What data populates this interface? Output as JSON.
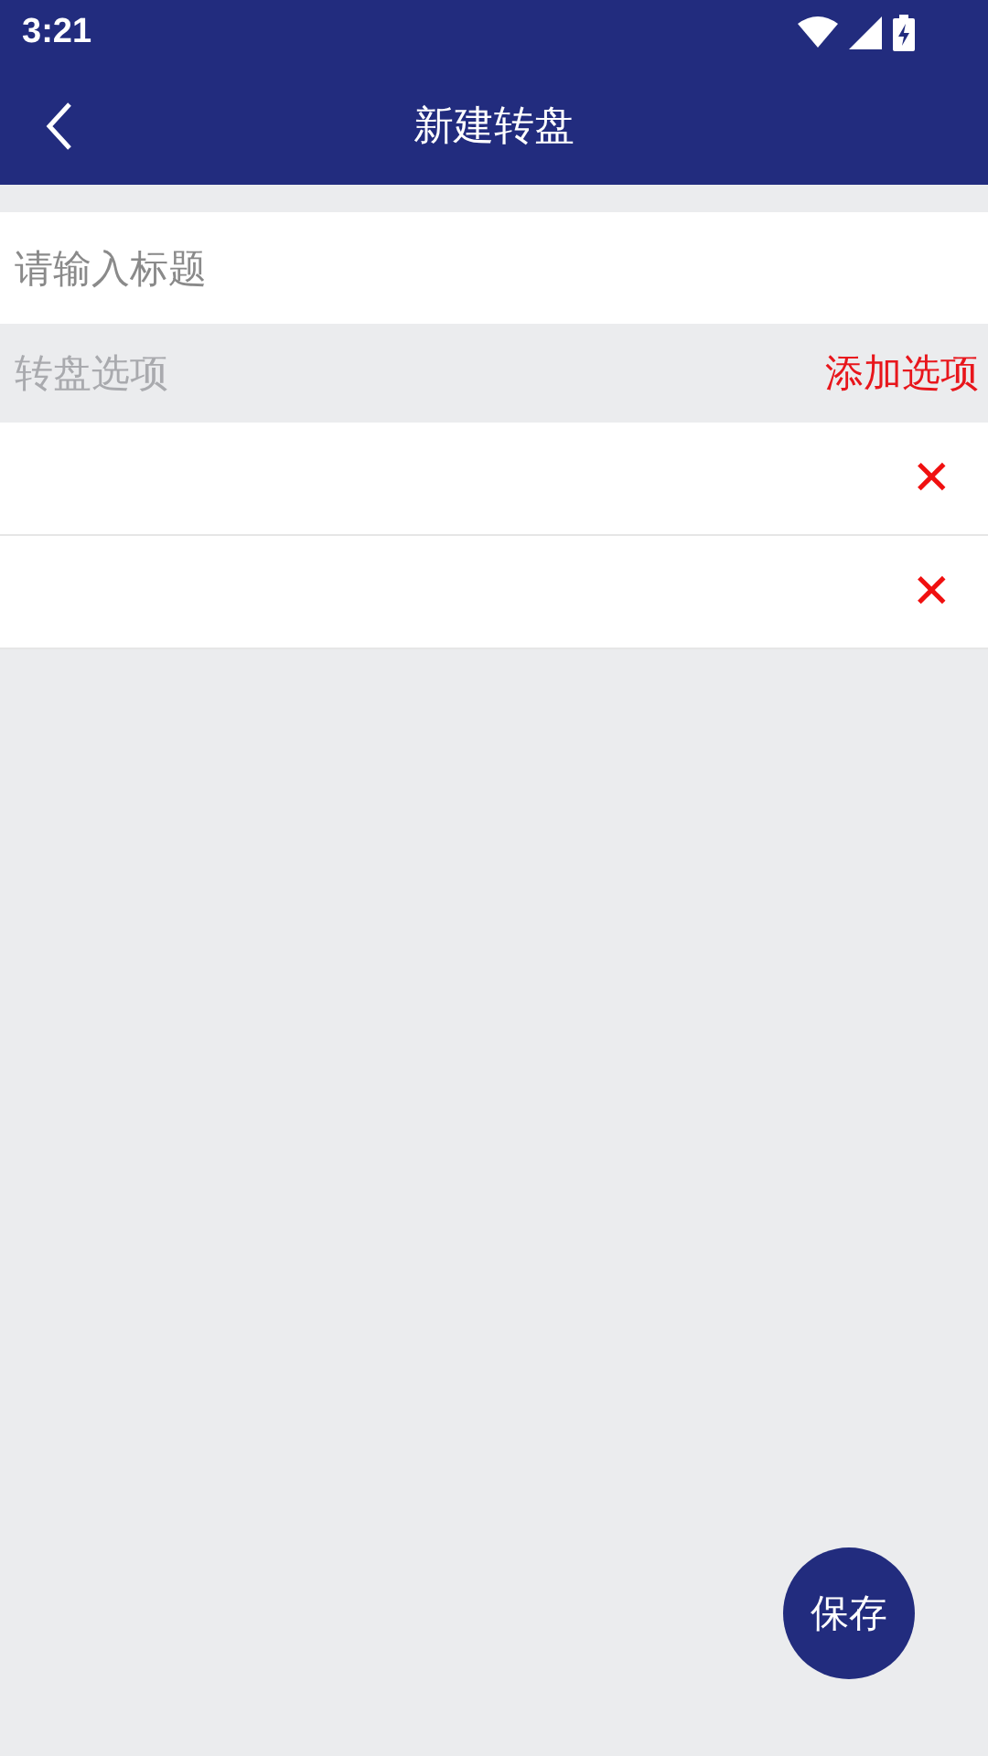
{
  "status_bar": {
    "time": "3:21"
  },
  "header": {
    "title": "新建转盘"
  },
  "title_field": {
    "placeholder": "请输入标题"
  },
  "options_section": {
    "label": "转盘选项",
    "add": "添加选项"
  },
  "options": [
    {
      "remove": "✕"
    },
    {
      "remove": "✕"
    }
  ],
  "save_button": "保存"
}
